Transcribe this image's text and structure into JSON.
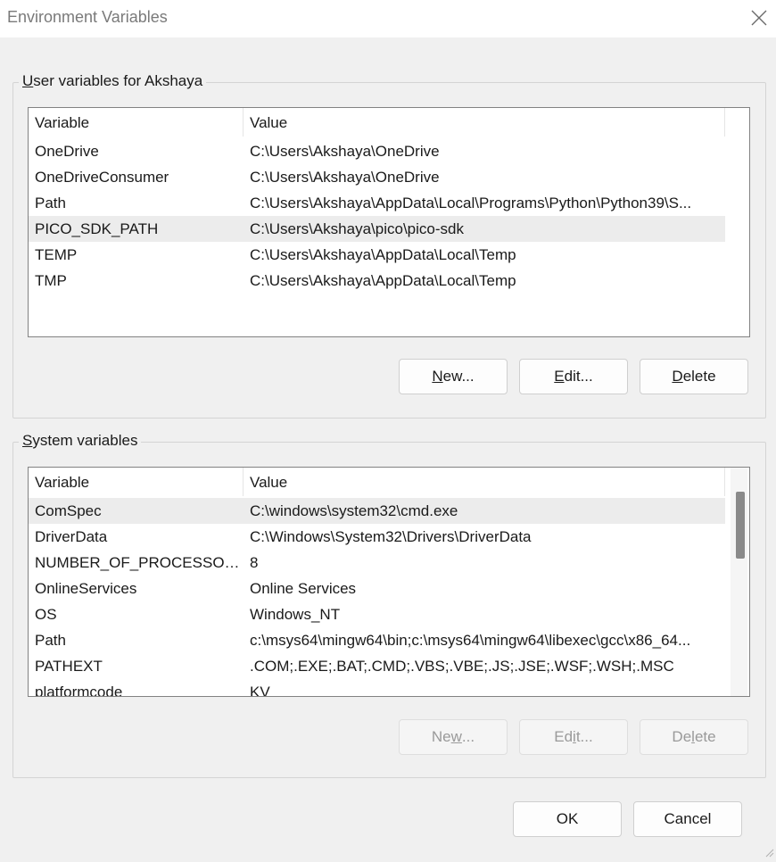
{
  "window": {
    "title": "Environment Variables"
  },
  "user": {
    "legend_prefix": "U",
    "legend_rest": "ser variables for Akshaya",
    "columns": [
      "Variable",
      "Value"
    ],
    "rows": [
      {
        "variable": "OneDrive",
        "value": "C:\\Users\\Akshaya\\OneDrive"
      },
      {
        "variable": "OneDriveConsumer",
        "value": "C:\\Users\\Akshaya\\OneDrive"
      },
      {
        "variable": "Path",
        "value": "C:\\Users\\Akshaya\\AppData\\Local\\Programs\\Python\\Python39\\S..."
      },
      {
        "variable": "PICO_SDK_PATH",
        "value": "C:\\Users\\Akshaya\\pico\\pico-sdk"
      },
      {
        "variable": "TEMP",
        "value": "C:\\Users\\Akshaya\\AppData\\Local\\Temp"
      },
      {
        "variable": "TMP",
        "value": "C:\\Users\\Akshaya\\AppData\\Local\\Temp"
      }
    ],
    "selected_index": 3,
    "buttons": {
      "new": {
        "ul": "N",
        "rest": "ew..."
      },
      "edit": {
        "ul": "E",
        "rest": "dit..."
      },
      "delete": {
        "ul": "D",
        "rest": "elete"
      }
    }
  },
  "system": {
    "legend_prefix": "S",
    "legend_rest": "ystem variables",
    "columns": [
      "Variable",
      "Value"
    ],
    "rows": [
      {
        "variable": "ComSpec",
        "value": "C:\\windows\\system32\\cmd.exe"
      },
      {
        "variable": "DriverData",
        "value": "C:\\Windows\\System32\\Drivers\\DriverData"
      },
      {
        "variable": "NUMBER_OF_PROCESSORS",
        "value": "8"
      },
      {
        "variable": "OnlineServices",
        "value": "Online Services"
      },
      {
        "variable": "OS",
        "value": "Windows_NT"
      },
      {
        "variable": "Path",
        "value": "c:\\msys64\\mingw64\\bin;c:\\msys64\\mingw64\\libexec\\gcc\\x86_64..."
      },
      {
        "variable": "PATHEXT",
        "value": ".COM;.EXE;.BAT;.CMD;.VBS;.VBE;.JS;.JSE;.WSF;.WSH;.MSC"
      },
      {
        "variable": "platformcode",
        "value": "KV"
      }
    ],
    "selected_index": 0,
    "buttons": {
      "new": {
        "pre": "Ne",
        "ul": "w",
        "rest": "..."
      },
      "edit": {
        "pre": "Ed",
        "ul": "i",
        "rest": "t..."
      },
      "delete": {
        "pre": "De",
        "ul": "l",
        "rest": "ete"
      }
    }
  },
  "footer": {
    "ok": "OK",
    "cancel": "Cancel"
  },
  "icons": {
    "close": "close-icon"
  }
}
